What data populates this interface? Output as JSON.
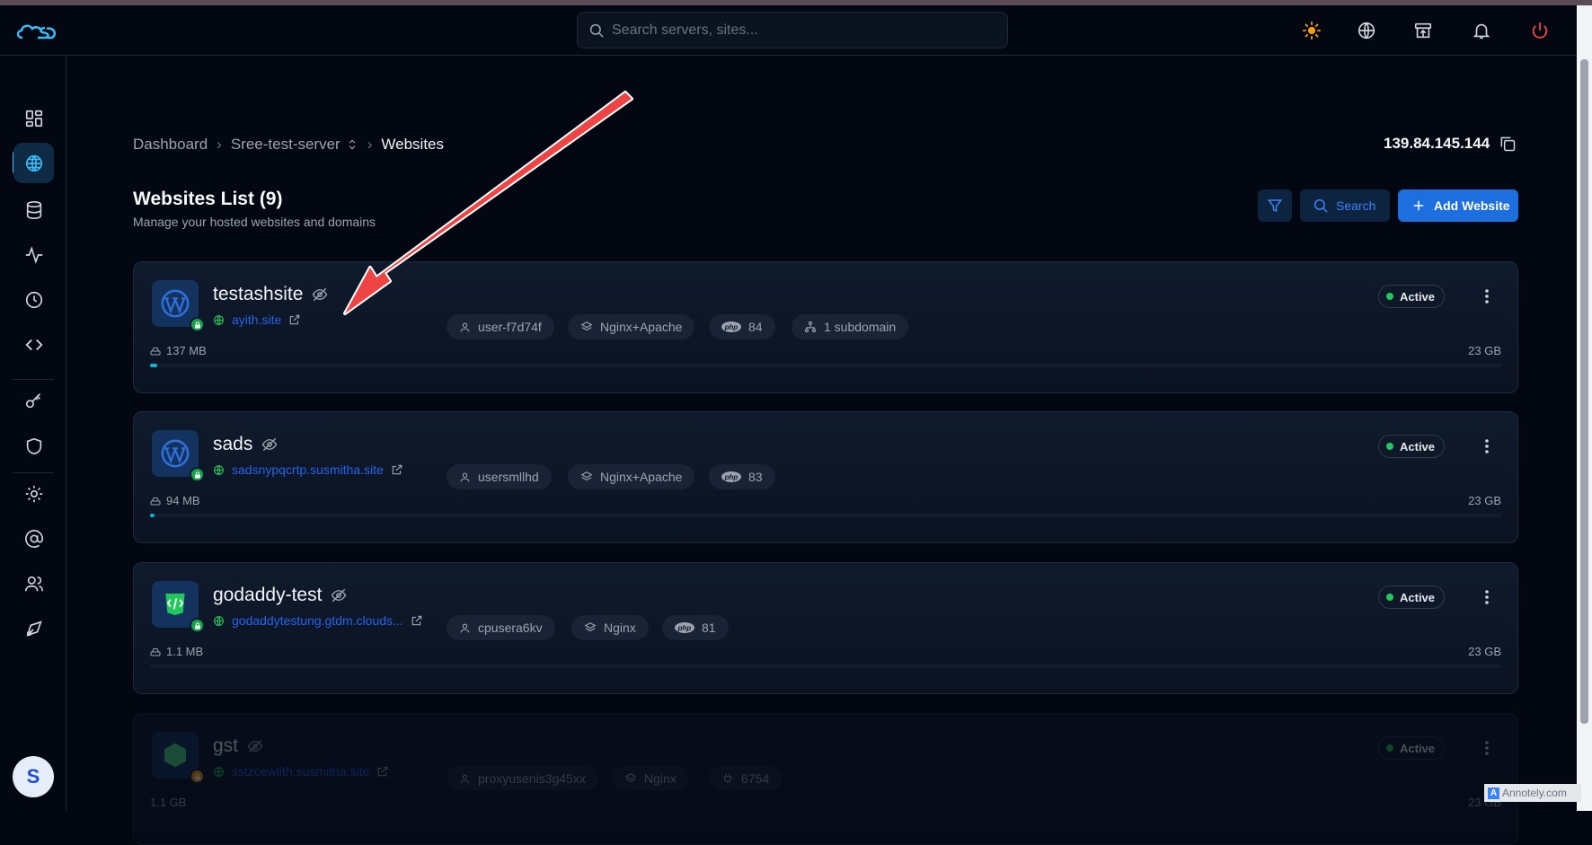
{
  "topbar": {
    "search_placeholder": "Search servers, sites...",
    "icons": [
      "logo-icon",
      "theme-sun-icon",
      "globe-icon",
      "archive-icon",
      "bell-icon",
      "power-icon"
    ]
  },
  "sidebar": {
    "icons": [
      "dashboard-icon",
      "websites-icon",
      "database-icon",
      "activity-icon",
      "clock-icon",
      "code-icon",
      "key-icon",
      "shield-icon",
      "settings-icon",
      "at-icon",
      "users-icon",
      "deploy-icon"
    ],
    "active": "websites-icon",
    "avatar_initial": "S"
  },
  "breadcrumb": {
    "items": [
      "Dashboard",
      "Sree-test-server",
      "Websites"
    ]
  },
  "server_ip": "139.84.145.144",
  "page": {
    "title": "Websites List (9)",
    "subtitle": "Manage your hosted websites and domains",
    "search_label": "Search",
    "add_label": "Add Website"
  },
  "websites": [
    {
      "name": "testashsite",
      "domain": "ayith.site",
      "user": "user-f7d74f",
      "stack": "Nginx+Apache",
      "php": "84",
      "extra": "1 subdomain",
      "status": "Active",
      "usage": "137 MB",
      "quota": "23 GB",
      "usage_fraction": 0.006,
      "type": "wordpress"
    },
    {
      "name": "sads",
      "domain": "sadsnypqcrtp.susmitha.site",
      "user": "usersmllhd",
      "stack": "Nginx+Apache",
      "php": "83",
      "status": "Active",
      "usage": "94 MB",
      "quota": "23 GB",
      "usage_fraction": 0.004,
      "type": "wordpress"
    },
    {
      "name": "godaddy-test",
      "domain": "godaddytestung.gtdm.clouds...",
      "user": "cpusera6kv",
      "stack": "Nginx",
      "php": "81",
      "status": "Active",
      "usage": "1.1 MB",
      "quota": "23 GB",
      "usage_fraction": 0,
      "type": "html"
    },
    {
      "name": "gst",
      "domain": "sstzcewlith.susmitha.site",
      "user": "proxyusenis3g45xx",
      "stack": "Nginx",
      "port": "6754",
      "status": "Active",
      "usage": "1.1 GB",
      "quota": "23 GB",
      "type": "node"
    }
  ],
  "watermark": "Annotely.com",
  "colors": {
    "accent": "#1d6fe0",
    "active": "#22c55e",
    "link": "#2563eb",
    "arrow": "#ef4444"
  }
}
